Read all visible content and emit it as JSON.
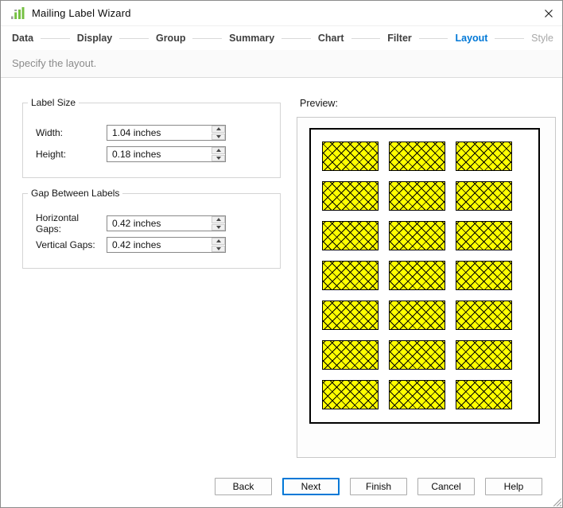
{
  "window": {
    "title": "Mailing Label Wizard"
  },
  "steps": [
    {
      "label": "Data",
      "state": "done"
    },
    {
      "label": "Display",
      "state": "done"
    },
    {
      "label": "Group",
      "state": "done"
    },
    {
      "label": "Summary",
      "state": "done"
    },
    {
      "label": "Chart",
      "state": "done"
    },
    {
      "label": "Filter",
      "state": "done"
    },
    {
      "label": "Layout",
      "state": "active"
    },
    {
      "label": "Style",
      "state": "upcoming"
    }
  ],
  "subtitle": "Specify the layout.",
  "label_size": {
    "legend": "Label Size",
    "fields": [
      {
        "label": "Width:",
        "value": "1.04 inches"
      },
      {
        "label": "Height:",
        "value": "0.18 inches"
      }
    ]
  },
  "gaps": {
    "legend": "Gap Between Labels",
    "fields": [
      {
        "label": "Horizontal Gaps:",
        "value": "0.42 inches"
      },
      {
        "label": "Vertical Gaps:",
        "value": "0.42 inches"
      }
    ]
  },
  "preview": {
    "label": "Preview:",
    "rows": 7,
    "columns": 3,
    "label_fill": "#ffff00",
    "hatch_color": "#000000"
  },
  "buttons": [
    {
      "label": "Back",
      "default": false
    },
    {
      "label": "Next",
      "default": true
    },
    {
      "label": "Finish",
      "default": false
    },
    {
      "label": "Cancel",
      "default": false
    },
    {
      "label": "Help",
      "default": false
    }
  ],
  "colors": {
    "accent_blue": "#0078d7",
    "icon_green": "#76c043",
    "icon_gray": "#9e9e9e",
    "step_done_text": "#3f3f3f",
    "step_upcoming_text": "#a8a8a8"
  },
  "icons": {
    "app": "bar-chart",
    "close": "✕",
    "spinner_up": "▲",
    "spinner_down": "▼",
    "resize_grip": "◿"
  }
}
